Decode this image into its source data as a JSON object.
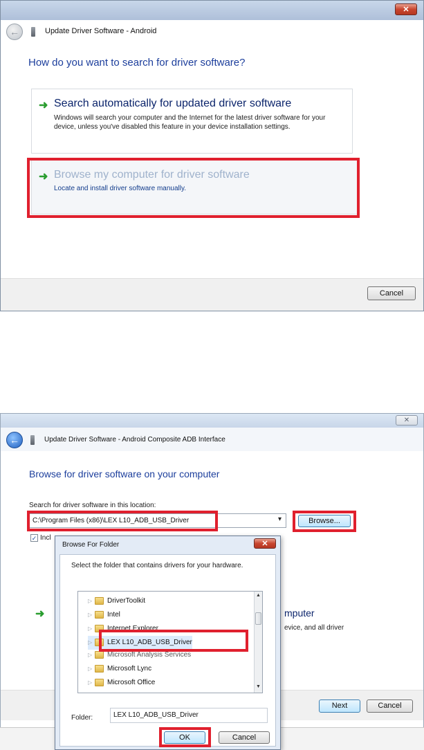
{
  "dialog1": {
    "window_title": "Update Driver Software - Android",
    "close_glyph": "✕",
    "heading": "How do you want to search for driver software?",
    "options": [
      {
        "title": "Search automatically for updated driver software",
        "description": "Windows will search your computer and the Internet for the latest driver software for your device, unless you've disabled this feature in your device installation settings."
      },
      {
        "title": "Browse my computer for driver software",
        "description": "Locate and install driver software manually."
      }
    ],
    "cancel_label": "Cancel"
  },
  "dialog2": {
    "window_title": "Update Driver Software - Android Composite ADB Interface",
    "close_glyph": "✕",
    "heading": "Browse for driver software on your computer",
    "search_label": "Search for driver software in this location:",
    "path_value": "C:\\Program Files (x86)\\LEX L10_ADB_USB_Driver",
    "dropdown_glyph": "▾",
    "browse_label": "Browse...",
    "include_subfolders_label": "Incl",
    "include_subfolders_checked": true,
    "background_option_title_fragment": "mputer",
    "background_option_desc_fragment": "evice, and all driver",
    "next_label": "Next",
    "cancel_label": "Cancel"
  },
  "browse_folder": {
    "title": "Browse For Folder",
    "instruction": "Select the folder that contains drivers for your hardware.",
    "tree_items": [
      {
        "label": "DriverToolkit"
      },
      {
        "label": "Intel"
      },
      {
        "label": "Internet Explorer"
      },
      {
        "label": "LEX L10_ADB_USB_Driver",
        "selected": true
      },
      {
        "label": "Microsoft Analysis Services"
      },
      {
        "label": "Microsoft Lync"
      },
      {
        "label": "Microsoft Office"
      }
    ],
    "folder_label": "Folder:",
    "folder_value": "LEX L10_ADB_USB_Driver",
    "ok_label": "OK",
    "cancel_label": "Cancel"
  },
  "colors": {
    "highlight_red": "#e0202e",
    "heading_blue": "#1c3e9c",
    "arrow_green": "#2a9d2f"
  }
}
